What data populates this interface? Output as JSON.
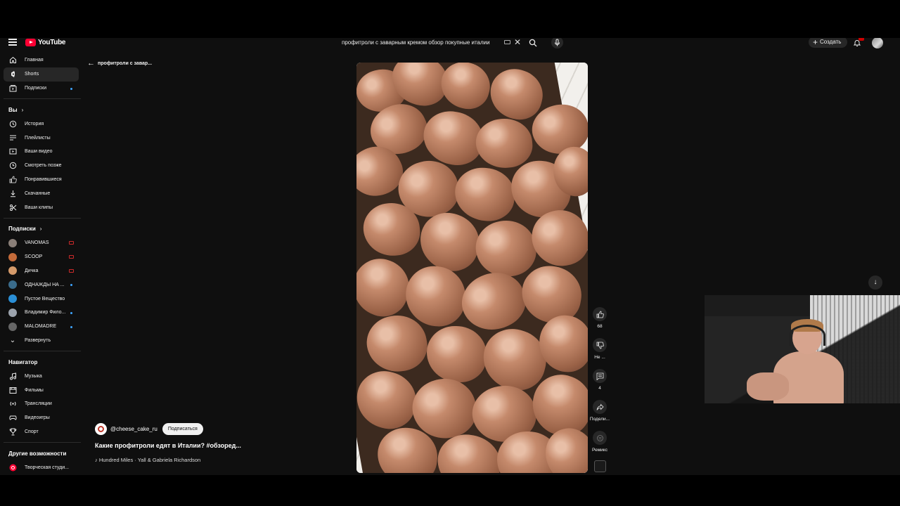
{
  "header": {
    "logo_text": "YouTube",
    "search_value": "профитроли с заварным кремом обзор покупные италии",
    "create_label": "Создать"
  },
  "sidebar": {
    "main": [
      {
        "label": "Главная",
        "icon": "home-icon"
      },
      {
        "label": "Shorts",
        "icon": "shorts-icon",
        "selected": true
      },
      {
        "label": "Подписки",
        "icon": "subscriptions-icon",
        "dot": true
      }
    ],
    "you_header": "Вы",
    "you": [
      {
        "label": "История",
        "icon": "history-icon"
      },
      {
        "label": "Плейлисты",
        "icon": "playlists-icon"
      },
      {
        "label": "Ваши видео",
        "icon": "your-videos-icon"
      },
      {
        "label": "Смотреть позже",
        "icon": "watch-later-icon"
      },
      {
        "label": "Понравившиеся",
        "icon": "liked-icon"
      },
      {
        "label": "Скачанные",
        "icon": "downloads-icon"
      },
      {
        "label": "Ваши клипы",
        "icon": "clips-icon"
      }
    ],
    "subs_header": "Подписки",
    "subs": [
      {
        "label": "VANOMAS",
        "status": "live",
        "color": "#8a7f78"
      },
      {
        "label": "SCOOP",
        "status": "live",
        "color": "#c46b3a"
      },
      {
        "label": "Дичка",
        "status": "live",
        "color": "#d49a6a"
      },
      {
        "label": "ОДНАЖДЫ НА ...",
        "status": "dot",
        "color": "#3a6c8c"
      },
      {
        "label": "Пустое Вещество",
        "status": "",
        "color": "#2a8fd6"
      },
      {
        "label": "Владимир Фило...",
        "status": "dot",
        "color": "#9ca3ad"
      },
      {
        "label": "MALOMADRE",
        "status": "dot",
        "color": "#666666"
      }
    ],
    "expand_label": "Развернуть",
    "nav_header": "Навигатор",
    "nav": [
      {
        "label": "Музыка",
        "icon": "music-icon"
      },
      {
        "label": "Фильмы",
        "icon": "movies-icon"
      },
      {
        "label": "Трансляции",
        "icon": "live-icon"
      },
      {
        "label": "Видеоигры",
        "icon": "gaming-icon"
      },
      {
        "label": "Спорт",
        "icon": "sport-icon"
      }
    ],
    "more_header": "Другие возможности",
    "more": [
      {
        "label": "Творческая студи...",
        "icon": "studio-icon"
      }
    ]
  },
  "short": {
    "back_label": "профитроли с завар...",
    "channel": "@cheese_cake_ru",
    "subscribe_label": "Подписаться",
    "title": "Какие профитроли едят в Италии? #обзоред...",
    "music": "Hundred Miles · Yall & Gabriela Richardson",
    "actions": {
      "likes": "68",
      "dislike": "Не ...",
      "comments": "4",
      "share": "Подели...",
      "remix": "Ремикс"
    }
  },
  "colors": {
    "accent": "#ff0033",
    "bg": "#0f0f0f",
    "chip": "#272727"
  }
}
